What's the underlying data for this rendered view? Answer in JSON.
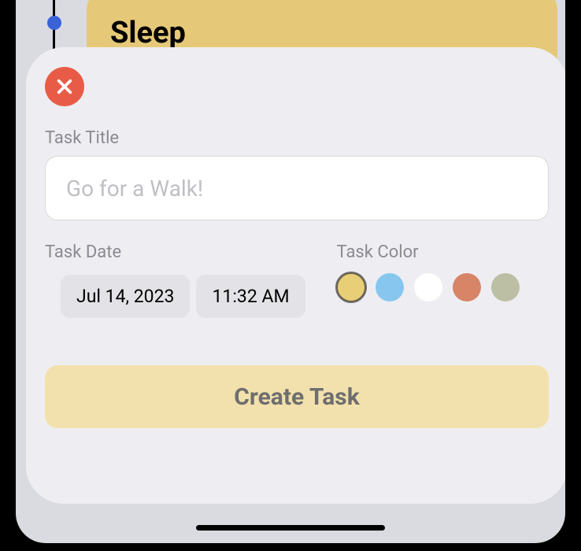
{
  "background": {
    "task_title": "Sleep"
  },
  "modal": {
    "title_label": "Task Title",
    "title_placeholder": "Go for a Walk!",
    "title_value": "",
    "date_label": "Task Date",
    "date_value": "Jul 14, 2023",
    "time_value": "11:32 AM",
    "color_label": "Task Color",
    "colors": {
      "yellow": "#e9ce78",
      "blue": "#87c7ef",
      "white": "#ffffff",
      "coral": "#d78467",
      "olive": "#bcbfa3"
    },
    "selected_color": "yellow",
    "create_label": "Create Task"
  }
}
